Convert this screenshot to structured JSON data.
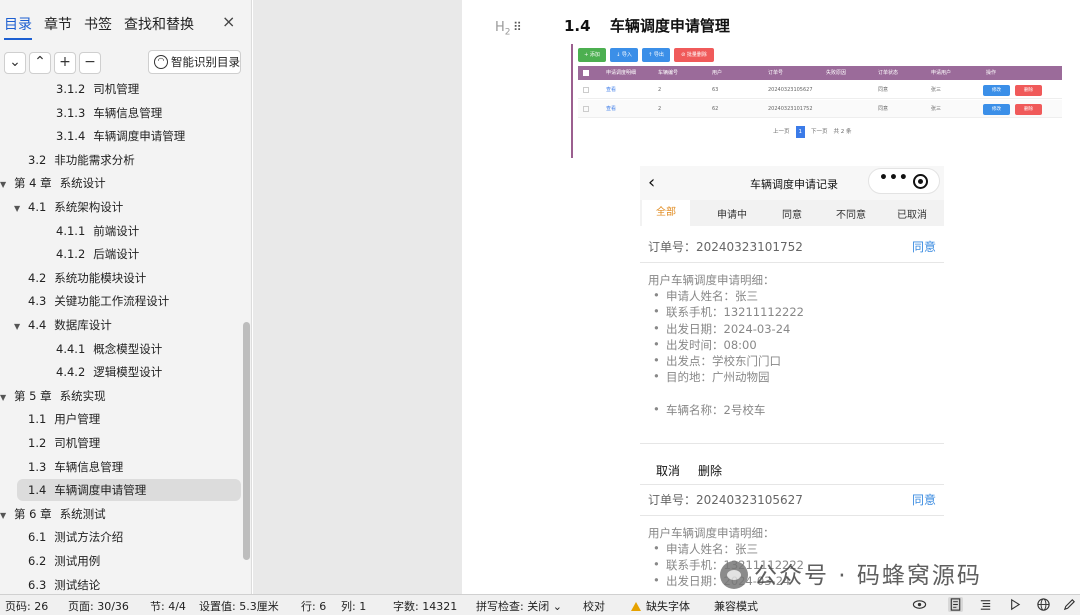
{
  "nav": {
    "tabs": [
      "目录",
      "章节",
      "书签",
      "查找和替换"
    ],
    "close_icon": "×",
    "tools": {
      "collapse": "⌄",
      "expand": "⌃",
      "add": "+",
      "remove": "−",
      "smart_label": "智能识别目录"
    },
    "toc": [
      {
        "num": "3.1.2",
        "title": "司机管理",
        "level": 3,
        "arrow": false,
        "selected": false
      },
      {
        "num": "3.1.3",
        "title": "车辆信息管理",
        "level": 3,
        "arrow": false,
        "selected": false
      },
      {
        "num": "3.1.4",
        "title": "车辆调度申请管理",
        "level": 3,
        "arrow": false,
        "selected": false
      },
      {
        "num": "3.2",
        "title": "非功能需求分析",
        "level": 2,
        "arrow": false,
        "selected": false
      },
      {
        "num": "第 4 章",
        "title": "系统设计",
        "level": 1,
        "arrow": true,
        "selected": false
      },
      {
        "num": "4.1",
        "title": "系统架构设计",
        "level": 2,
        "arrow": true,
        "selected": false
      },
      {
        "num": "4.1.1",
        "title": "前端设计",
        "level": 3,
        "arrow": false,
        "selected": false
      },
      {
        "num": "4.1.2",
        "title": "后端设计",
        "level": 3,
        "arrow": false,
        "selected": false
      },
      {
        "num": "4.2",
        "title": "系统功能模块设计",
        "level": 2,
        "arrow": false,
        "selected": false
      },
      {
        "num": "4.3",
        "title": "关键功能工作流程设计",
        "level": 2,
        "arrow": false,
        "selected": false
      },
      {
        "num": "4.4",
        "title": "数据库设计",
        "level": 2,
        "arrow": true,
        "selected": false
      },
      {
        "num": "4.4.1",
        "title": "概念模型设计",
        "level": 3,
        "arrow": false,
        "selected": false
      },
      {
        "num": "4.4.2",
        "title": "逻辑模型设计",
        "level": 3,
        "arrow": false,
        "selected": false
      },
      {
        "num": "第 5 章",
        "title": "系统实现",
        "level": 1,
        "arrow": true,
        "selected": false
      },
      {
        "num": "1.1",
        "title": "用户管理",
        "level": 2,
        "arrow": false,
        "selected": false
      },
      {
        "num": "1.2",
        "title": "司机管理",
        "level": 2,
        "arrow": false,
        "selected": false
      },
      {
        "num": "1.3",
        "title": "车辆信息管理",
        "level": 2,
        "arrow": false,
        "selected": false
      },
      {
        "num": "1.4",
        "title": "车辆调度申请管理",
        "level": 2,
        "arrow": false,
        "selected": true
      },
      {
        "num": "第 6 章",
        "title": "系统测试",
        "level": 1,
        "arrow": true,
        "selected": false
      },
      {
        "num": "6.1",
        "title": "测试方法介绍",
        "level": 2,
        "arrow": false,
        "selected": false
      },
      {
        "num": "6.2",
        "title": "测试用例",
        "level": 2,
        "arrow": false,
        "selected": false
      },
      {
        "num": "6.3",
        "title": "测试结论",
        "level": 2,
        "arrow": false,
        "selected": false
      }
    ]
  },
  "doc": {
    "heading_marker": "H",
    "heading_marker_sub": "2",
    "heading_num": "1.4",
    "heading_text": "车辆调度申请管理"
  },
  "admin_shot": {
    "buttons": [
      {
        "label": "+ 添加",
        "color": "#4caf50"
      },
      {
        "label": "↓ 导入",
        "color": "#3b8fe8"
      },
      {
        "label": "↑ 导出",
        "color": "#3b8fe8"
      },
      {
        "label": "⊘ 批量删除",
        "color": "#f05a5a"
      }
    ],
    "headers": [
      "申请调度明细",
      "车辆编号",
      "用户",
      "订单号",
      "失败原因",
      "订单状态",
      "申请用户",
      "操作"
    ],
    "rows": [
      {
        "cells": [
          "查看",
          "2",
          "63",
          "20240323105627",
          "",
          "同意",
          "张三"
        ],
        "edit": "修改",
        "delete": "删除"
      },
      {
        "cells": [
          "查看",
          "2",
          "62",
          "20240323101752",
          "",
          "同意",
          "张三"
        ],
        "edit": "修改",
        "delete": "删除"
      }
    ],
    "pager": {
      "prev": "上一页",
      "current": "1",
      "next": "下一页",
      "total": "共 2 条"
    }
  },
  "mobile_shot": {
    "back_icon": "‹",
    "title": "车辆调度申请记录",
    "capsule_dots": "•••",
    "tabs": [
      "全部",
      "申请中",
      "同意",
      "不同意",
      "已取消"
    ],
    "orders": [
      {
        "order_label": "订单号：20240323101752",
        "status": "同意",
        "detail_title": "用户车辆调度申请明细：",
        "items": [
          "申请人姓名：张三",
          "联系手机：13211112222",
          "出发日期：2024-03-24",
          "出发时间：08:00",
          "出发点：学校东门门口",
          "目的地：广州动物园"
        ],
        "car": "车辆名称：2号校车",
        "cancel": "取消",
        "delete": "删除"
      },
      {
        "order_label": "订单号：20240323105627",
        "status": "同意",
        "detail_title": "用户车辆调度申请明细：",
        "items": [
          "申请人姓名：张三",
          "联系手机：13211112222",
          "出发日期：2024-03-24"
        ]
      }
    ]
  },
  "watermark": "公众号 · 码蜂窝源码",
  "status": {
    "page_code": "页码: 26",
    "page": "页面: 30/36",
    "section": "节: 4/4",
    "setting": "设置值: 5.3厘米",
    "row": "行: 6",
    "col": "列: 1",
    "words": "字数: 14321",
    "spell": "拼写检查: 关闭",
    "spell_caret": "⌄",
    "proof": "校对",
    "missing_font": "缺失字体",
    "compat": "兼容模式"
  }
}
